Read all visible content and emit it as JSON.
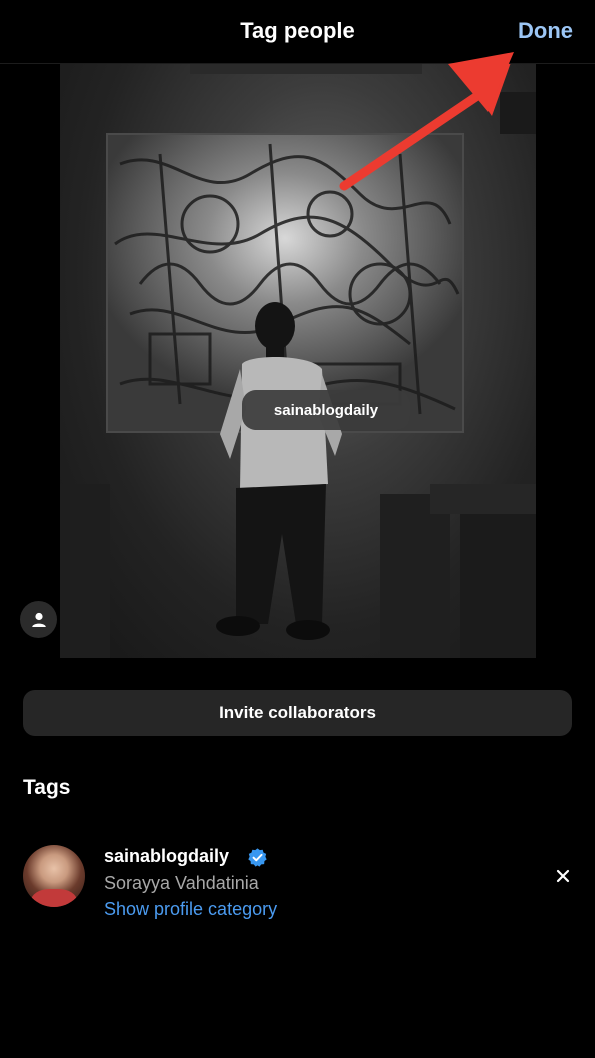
{
  "header": {
    "title": "Tag people",
    "done_label": "Done"
  },
  "photo": {
    "tag_label": "sainablogdaily"
  },
  "invite_button_label": "Invite collaborators",
  "tags_heading": "Tags",
  "tags": [
    {
      "username": "sainablogdaily",
      "full_name": "Sorayya Vahdatinia",
      "category_link": "Show profile category",
      "verified": true
    }
  ],
  "colors": {
    "background": "#000000",
    "done_accent": "#9cc6f5",
    "link_blue": "#4b9bf0",
    "verified_blue": "#3897f0",
    "annotation_arrow": "#ec3b30"
  },
  "icons": {
    "people": "person-icon",
    "verified": "verified-badge-icon",
    "remove": "close-icon"
  }
}
